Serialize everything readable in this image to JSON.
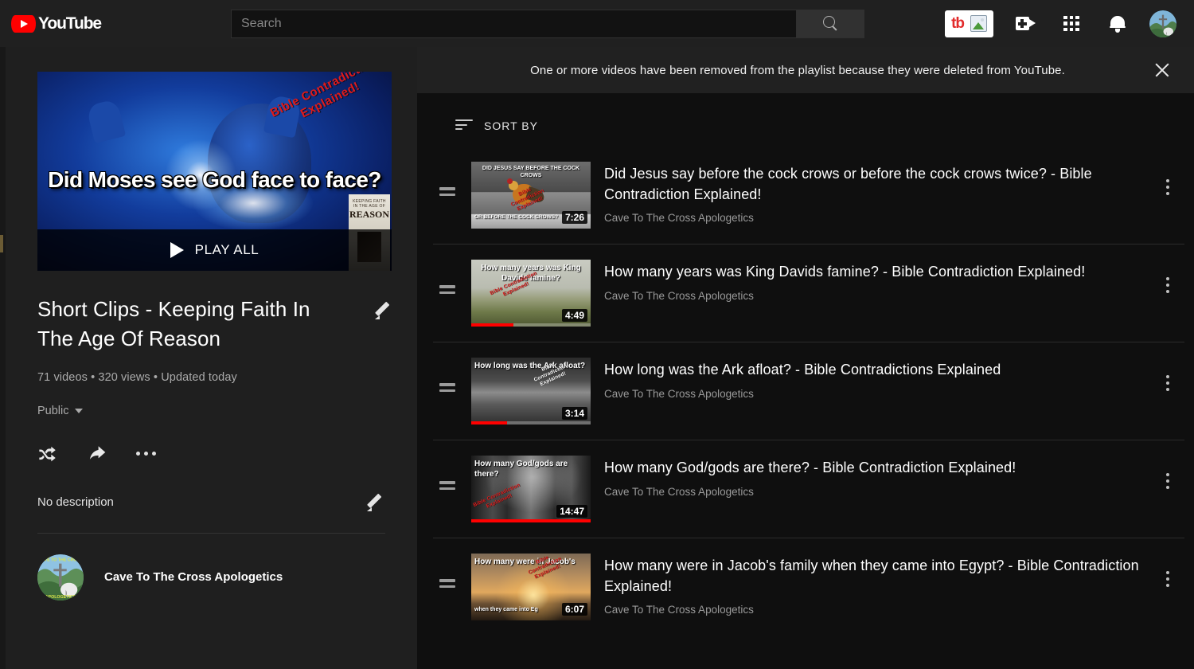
{
  "header": {
    "logo_text": "YouTube",
    "search": {
      "placeholder": "Search",
      "value": ""
    },
    "icons": {
      "search": "search-icon",
      "tubebuddy": "tb",
      "create": "video-camera-plus-icon",
      "apps": "apps-grid-icon",
      "notifications": "bell-icon",
      "account": "account-avatar"
    }
  },
  "banner": {
    "message": "One or more videos have been removed from the playlist because they were deleted from YouTube.",
    "close_label": "×"
  },
  "playlist": {
    "thumbnail": {
      "title": "Did Moses see God face to face?",
      "stamp_line1": "Bible Contradiction",
      "stamp_line2": "Explained!",
      "book_line1": "KEEPING FAITH",
      "book_line2": "REASON",
      "book_sub": "IN THE AGE OF"
    },
    "play_all_label": "PLAY ALL",
    "title": "Short Clips - Keeping Faith In The Age Of Reason",
    "meta": "71 videos •  320 views •  Updated today",
    "video_count": "71 videos",
    "views": "320 views",
    "updated": "Updated today",
    "privacy": "Public",
    "description": "No description",
    "channel": "Cave To The Cross Apologetics",
    "actions": {
      "shuffle": "shuffle-icon",
      "share": "share-icon",
      "more": "more-actions-icon",
      "edit_title": "edit-title-icon",
      "edit_description": "edit-description-icon"
    }
  },
  "list": {
    "sort_label": "SORT BY",
    "videos": [
      {
        "title": "Did Jesus say before the cock crows or before the cock crows twice? - Bible Contradiction Explained!",
        "channel": "Cave To The Cross Apologetics",
        "duration": "7:26",
        "progress": 0,
        "thumb_top_text": "DID JESUS SAY BEFORE THE COCK CROWS",
        "thumb_bottom_text": "OR BEFORE THE COCK CROWS?",
        "thumb_stamp": "Bible Contradiction Explained!"
      },
      {
        "title": "How many years was King Davids famine? - Bible Contradiction Explained!",
        "channel": "Cave To The Cross Apologetics",
        "duration": "4:49",
        "progress": 35,
        "thumb_top_text": "How many years was King Davids famine?",
        "thumb_bottom_text": "",
        "thumb_stamp": "Bible Contradiction Explained!"
      },
      {
        "title": "How long was the Ark afloat? - Bible Contradictions Explained",
        "channel": "Cave To The Cross Apologetics",
        "duration": "3:14",
        "progress": 30,
        "thumb_top_text": "How long was the Ark afloat?",
        "thumb_bottom_text": "",
        "thumb_stamp": "Bible Contradiction Explained!"
      },
      {
        "title": "How many God/gods are there? - Bible Contradiction Explained!",
        "channel": "Cave To The Cross Apologetics",
        "duration": "14:47",
        "progress": 100,
        "thumb_top_text": "How many God/gods are there?",
        "thumb_bottom_text": "",
        "thumb_stamp": "Bible Contradiction Explained!"
      },
      {
        "title": "How many were in Jacob's family when they came into Egypt? - Bible Contradiction Explained!",
        "channel": "Cave To The Cross Apologetics",
        "duration": "6:07",
        "progress": 0,
        "thumb_top_text": "How many were in Jacob's",
        "thumb_bottom_text": "when they came into Eg",
        "thumb_stamp": "Bible Contradiction Explained!"
      }
    ]
  },
  "colors": {
    "brand_red": "#ff0000",
    "header_bg": "#202020",
    "left_panel_bg": "#1f1f1f",
    "right_panel_bg": "#0f0f0f",
    "banner_bg": "#212121",
    "stamp_red": "#e01b1b"
  }
}
